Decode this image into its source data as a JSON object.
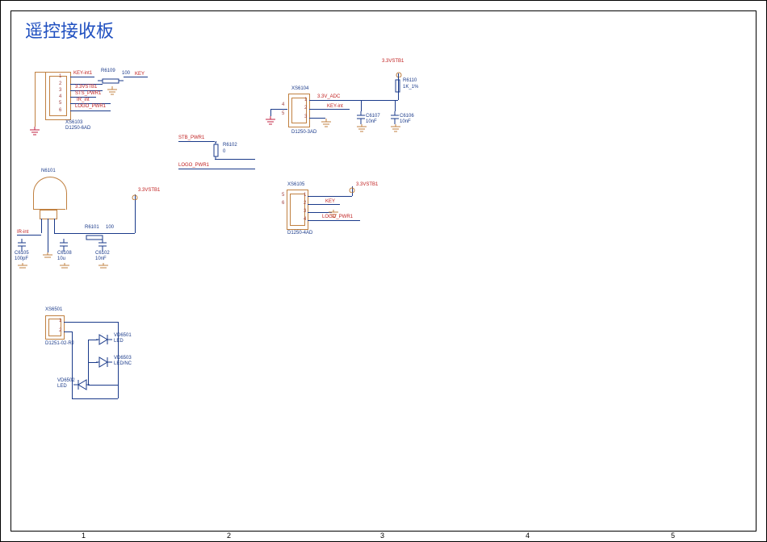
{
  "title": "遥控接收板",
  "ruler": {
    "bottom": [
      "1",
      "2",
      "3",
      "4",
      "5"
    ]
  },
  "connectors": {
    "xs6103": {
      "ref": "XS6103",
      "val": "D1250-6AD",
      "pins": [
        "1",
        "2",
        "3",
        "4",
        "5",
        "6"
      ]
    },
    "xs6104": {
      "ref": "XS6104",
      "val": "D1250-3AD",
      "pins": [
        "1",
        "2",
        "3"
      ]
    },
    "xs6105": {
      "ref": "XS6105",
      "val": "D1250-4AD",
      "pins": [
        "1",
        "2",
        "3",
        "4"
      ]
    },
    "xs6501": {
      "ref": "XS6501",
      "val": "D1251-02-RJ",
      "pins": [
        "1",
        "2"
      ]
    }
  },
  "components": {
    "n6101": {
      "ref": "N6101"
    },
    "r6109": {
      "ref": "R6109",
      "val": "100"
    },
    "r6110": {
      "ref": "R6110",
      "val": "1K_1%"
    },
    "r6102": {
      "ref": "R6102",
      "val": "0"
    },
    "r6101": {
      "ref": "R6101",
      "val": "100"
    },
    "c6107": {
      "ref": "C6107",
      "val": "10nF"
    },
    "c6106": {
      "ref": "C6106",
      "val": "10nF"
    },
    "c6105": {
      "ref": "C6105",
      "val": "100pF"
    },
    "c6108": {
      "ref": "C6108",
      "val": "10u"
    },
    "c6102": {
      "ref": "C6102",
      "val": "10nF"
    },
    "vd6501": {
      "ref": "VD6501",
      "val": "LED"
    },
    "vd6502": {
      "ref": "VD6502",
      "val": "LED"
    },
    "vd6503": {
      "ref": "VD6503",
      "val": "LED/NC"
    }
  },
  "nets": {
    "key_int": "KEY-int",
    "key_int1": "KEY-int1",
    "v33stb1": "3.3VSTB1",
    "sts_pwr1": "STS_PWR1",
    "ir_int": "IR_int",
    "logo_pwr1": "LOGO_PWR1",
    "stb_pwr1": "STB_PWR1",
    "key": "KEY",
    "v33_adc": "3.3V_ADC",
    "ir_int_lower": "IR-int"
  }
}
